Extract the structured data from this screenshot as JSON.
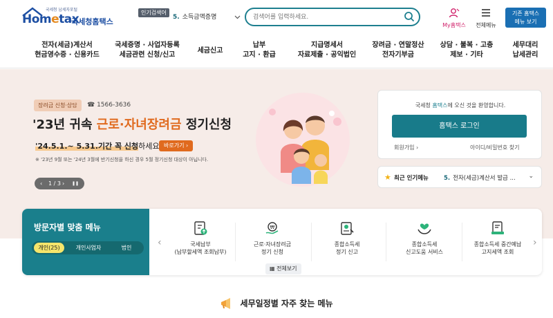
{
  "header": {
    "logo_tagline": "국세청 납세자포털",
    "logo_main_a": "Hom",
    "logo_main_e": "e",
    "logo_main_b": "tax",
    "logo_sub": "국세청홈택스",
    "popular_search_badge": "인기검색어",
    "popular_search_num": "5.",
    "popular_search_text": "소득금액증명",
    "search_placeholder": "검색어를 입력하세요.",
    "my_hometax_label": "My홈택스",
    "all_menu_label": "전체메뉴",
    "legacy_button": "기존 홈택스\n메뉴 보기"
  },
  "nav": [
    {
      "label": "전자(세금)계산서\n현금영수증 · 신용카드"
    },
    {
      "label": "국세증명 · 사업자등록\n세금관련 신청/신고"
    },
    {
      "label": "세금신고"
    },
    {
      "label": "납부\n고지 · 환급"
    },
    {
      "label": "지급명세서\n자료제출 · 공익법인"
    },
    {
      "label": "장려금 · 연말정산\n전자기부금"
    },
    {
      "label": "상담 · 불복 · 고충\n제보 · 기타"
    },
    {
      "label": "세무대리\n납세관리"
    }
  ],
  "hero": {
    "tag": "장려금 신청·상담",
    "phone": "☎ 1566-3636",
    "title_a": "'23년 귀속 ",
    "title_hl": "근로·자녀장려금",
    "title_b": " 정기신청",
    "period_hl": "'24.5.1.~ 5.31.기간 꼭 신청",
    "period_rest": "하세요!",
    "shortcut": "바로가기 ›",
    "note": "※ '23년 9월 또는 '24년 3월에 반기신청을 하신 경우 5월 정기신청 대상이 아닙니다.",
    "pager_text": "1 / 3",
    "pager_prev": "‹",
    "pager_next": "›",
    "pager_pause": "❚❚"
  },
  "login": {
    "welcome_a": "국세청 ",
    "welcome_hl": "홈택스",
    "welcome_b": "에 오신 것을 환영합니다.",
    "login_button": "홈택스 로그인",
    "join_link": "회원가입 ›",
    "find_link": "아이디/비밀번호 찾기"
  },
  "popular_menu": {
    "label": "최근 인기메뉴",
    "num": "5.",
    "item": "전자(세금)계산서 발급 ...",
    "chevron": "⌄"
  },
  "visitor": {
    "title": "방문자별 맞춤 메뉴",
    "tabs": [
      {
        "label": "개인(25)",
        "active": true
      },
      {
        "label": "개인사업자",
        "active": false
      },
      {
        "label": "법인",
        "active": false
      }
    ],
    "services": [
      {
        "label": "국세납부\n(납부할세액 조회납부)",
        "icon": "document-upload-icon"
      },
      {
        "label": "근로·자녀장려금\n정기 신청",
        "icon": "coin-hand-icon"
      },
      {
        "label": "종합소득세\n정기 신고",
        "icon": "tax-report-icon"
      },
      {
        "label": "종합소득세\n신고도움 서비스",
        "icon": "helping-hands-icon"
      },
      {
        "label": "종합소득세 중간예납\n고지세액 조회",
        "icon": "document-search-icon"
      }
    ],
    "prev_arrow": "‹",
    "next_arrow": "›",
    "view_all": "▦ 전체보기"
  },
  "schedule": {
    "title": "세무일정별 자주 찾는 메뉴",
    "icon": "megaphone-icon"
  },
  "colors": {
    "brand_teal": "#187b8a",
    "brand_blue": "#1d4fa3",
    "accent_orange": "#e06a1e",
    "hero_bg": "#f6ece8"
  }
}
